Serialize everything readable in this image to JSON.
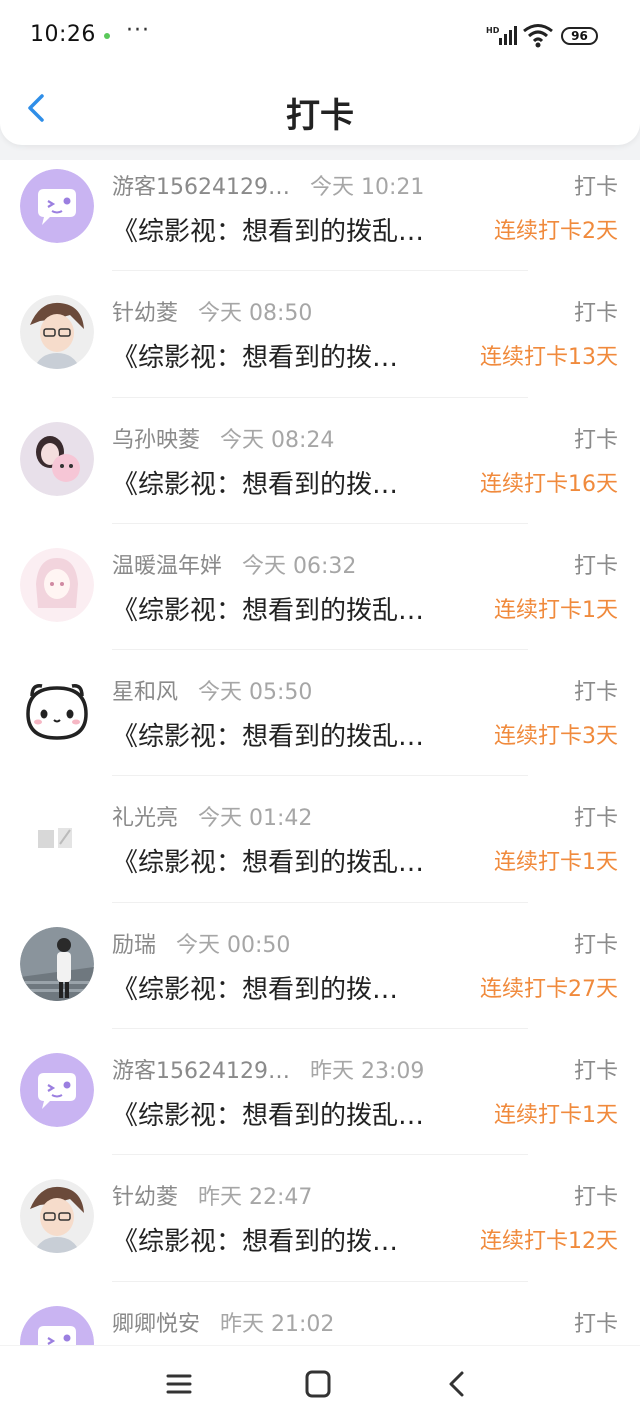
{
  "status_bar": {
    "time": "10:26",
    "more": "···",
    "battery": "96",
    "signal_icon": "hd-signal-icon",
    "wifi_icon": "wifi-icon"
  },
  "header": {
    "title": "打卡",
    "back_icon": "chevron-left-icon"
  },
  "list": [
    {
      "name": "游客15624129…",
      "time": "今天 10:21",
      "action": "打卡",
      "book": "《综影视：想看到的拨乱…",
      "streak": "连续打卡2天",
      "avatar": "chat-bubble-purple"
    },
    {
      "name": "针幼菱",
      "time": "今天 08:50",
      "action": "打卡",
      "book": "《综影视：想看到的拨…",
      "streak": "连续打卡13天",
      "avatar": "anime-boy-glasses"
    },
    {
      "name": "乌孙映菱",
      "time": "今天 08:24",
      "action": "打卡",
      "book": "《综影视：想看到的拨…",
      "streak": "连续打卡16天",
      "avatar": "girl-pink-toy"
    },
    {
      "name": "温暖温年姅",
      "time": "今天 06:32",
      "action": "打卡",
      "book": "《综影视：想看到的拨乱…",
      "streak": "连续打卡1天",
      "avatar": "anime-girl-pink"
    },
    {
      "name": "星和风",
      "time": "今天 05:50",
      "action": "打卡",
      "book": "《综影视：想看到的拨乱…",
      "streak": "连续打卡3天",
      "avatar": "cute-face"
    },
    {
      "name": "礼光亮",
      "time": "今天 01:42",
      "action": "打卡",
      "book": "《综影视：想看到的拨乱…",
      "streak": "连续打卡1天",
      "avatar": "faded-photo"
    },
    {
      "name": "励瑞",
      "time": "今天 00:50",
      "action": "打卡",
      "book": "《综影视：想看到的拨…",
      "streak": "连续打卡27天",
      "avatar": "person-stairs"
    },
    {
      "name": "游客15624129…",
      "time": "昨天 23:09",
      "action": "打卡",
      "book": "《综影视：想看到的拨乱…",
      "streak": "连续打卡1天",
      "avatar": "chat-bubble-purple"
    },
    {
      "name": "针幼菱",
      "time": "昨天 22:47",
      "action": "打卡",
      "book": "《综影视：想看到的拨…",
      "streak": "连续打卡12天",
      "avatar": "anime-boy-glasses"
    },
    {
      "name": "卿卿悦安",
      "time": "昨天 21:02",
      "action": "打卡",
      "book": "",
      "streak": "",
      "avatar": "chat-bubble-purple"
    }
  ],
  "nav_bar": {
    "menu_icon": "menu-icon",
    "home_icon": "home-square-icon",
    "back_icon": "back-triangle-icon"
  },
  "colors": {
    "streak": "#f08a3c",
    "back_arrow": "#2f8ee8",
    "avatar_purple": "#c9b4f2"
  }
}
